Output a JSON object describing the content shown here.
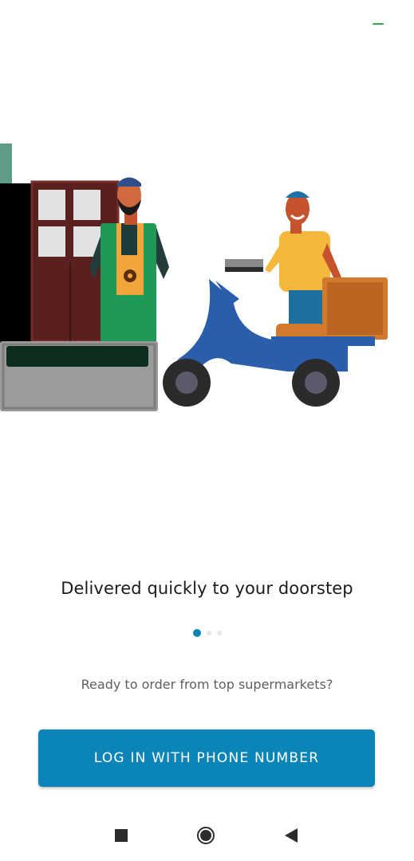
{
  "theme": {
    "accent": "#0b84b8"
  },
  "onboarding": {
    "headline": "Delivered quickly to your doorstep",
    "subtext": "Ready to order from top supermarkets?",
    "pager": {
      "active_index": 0,
      "total": 3
    }
  },
  "login_button": {
    "label": "LOG IN WITH PHONE NUMBER"
  },
  "icons": {
    "status": "minimize-dash-icon",
    "illustration": "delivery-scooter-illustration",
    "nav": [
      "recents-square-icon",
      "home-circle-icon",
      "back-triangle-icon"
    ]
  }
}
